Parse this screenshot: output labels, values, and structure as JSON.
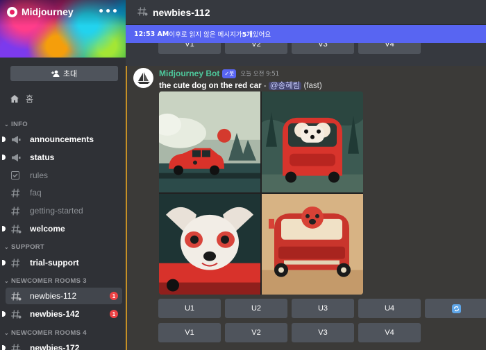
{
  "server": {
    "name": "Midjourney",
    "menu": "•••"
  },
  "sidebar": {
    "invite_label": "초대",
    "home_label": "홈",
    "categories": {
      "info": "INFO",
      "support": "SUPPORT",
      "newcomer3": "NEWCOMER ROOMS 3",
      "newcomer4": "NEWCOMER ROOMS 4"
    },
    "channels": {
      "announcements": "announcements",
      "status": "status",
      "rules": "rules",
      "faq": "faq",
      "getting_started": "getting-started",
      "welcome": "welcome",
      "trial_support": "trial-support",
      "newbies112": "newbies-112",
      "newbies142": "newbies-142",
      "newbies172": "newbies-172"
    },
    "badges": {
      "newbies112": "1",
      "newbies142": "1"
    }
  },
  "channel": {
    "title": "newbies-112"
  },
  "new_messages": {
    "time": "12:53 AM",
    "text_before": " 이후로 읽지 않은 메시지가 ",
    "count": "5개",
    "text_after": " 있어요"
  },
  "prev_buttons": [
    "V1",
    "V2",
    "V3",
    "V4"
  ],
  "message": {
    "author": "Midjourney Bot",
    "bot_tag": "봇",
    "timestamp": "오늘 오전 9:51",
    "prompt": "the cute dog on the red car",
    "separator": " - ",
    "mention": "@송혜림",
    "mode": " (fast)"
  },
  "upscale_buttons": [
    "U1",
    "U2",
    "U3",
    "U4"
  ],
  "variation_buttons": [
    "V1",
    "V2",
    "V3",
    "V4"
  ],
  "colors": {
    "accent": "#5865f2",
    "bot_name": "#4ec79b",
    "highlight_border": "#c69026",
    "unread_badge": "#ed4245"
  }
}
